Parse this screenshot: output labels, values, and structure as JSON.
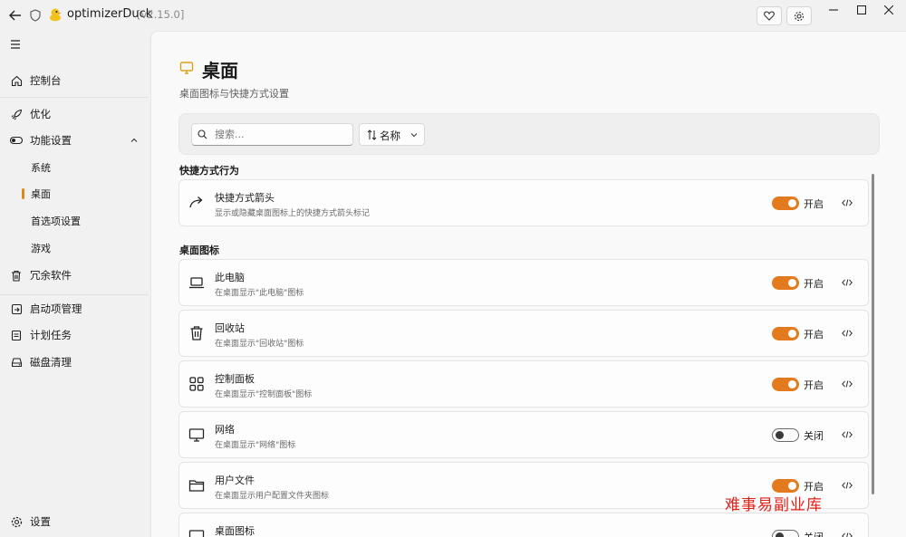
{
  "app": {
    "title": "optimizerDuck",
    "version": "[v2.15.0]"
  },
  "colors": {
    "accent": "#e47a1e",
    "active_indicator": "#d98b1c",
    "watermark": "#e0211a"
  },
  "sidebar": {
    "items": [
      {
        "label": "控制台",
        "icon": "home-icon"
      },
      {
        "label": "优化",
        "icon": "rocket-icon"
      },
      {
        "label": "功能设置",
        "icon": "toggle-icon",
        "expanded": true
      },
      {
        "label": "系统"
      },
      {
        "label": "桌面",
        "active": true
      },
      {
        "label": "首选项设置"
      },
      {
        "label": "游戏"
      },
      {
        "label": "冗余软件",
        "icon": "trash-icon"
      },
      {
        "label": "启动项管理",
        "icon": "startup-icon"
      },
      {
        "label": "计划任务",
        "icon": "task-icon"
      },
      {
        "label": "磁盘清理",
        "icon": "disk-icon"
      }
    ],
    "settings_label": "设置"
  },
  "page": {
    "title": "桌面",
    "subtitle": "桌面图标与快捷方式设置",
    "search_placeholder": "搜索...",
    "sort_label": "名称"
  },
  "sections": [
    {
      "heading": "快捷方式行为",
      "cards": [
        {
          "title": "快捷方式箭头",
          "desc": "显示或隐藏桌面图标上的快捷方式箭头标记",
          "state": "开启",
          "on": true,
          "icon": "arrow-icon"
        }
      ]
    },
    {
      "heading": "桌面图标",
      "cards": [
        {
          "title": "此电脑",
          "desc": "在桌面显示\"此电脑\"图标",
          "state": "开启",
          "on": true,
          "icon": "laptop-icon"
        },
        {
          "title": "回收站",
          "desc": "在桌面显示\"回收站\"图标",
          "state": "开启",
          "on": true,
          "icon": "recycle-bin-icon"
        },
        {
          "title": "控制面板",
          "desc": "在桌面显示\"控制面板\"图标",
          "state": "开启",
          "on": true,
          "icon": "grid-icon"
        },
        {
          "title": "网络",
          "desc": "在桌面显示\"网络\"图标",
          "state": "关闭",
          "on": false,
          "icon": "monitor-icon"
        },
        {
          "title": "用户文件",
          "desc": "在桌面显示用户配置文件夹图标",
          "state": "开启",
          "on": true,
          "icon": "folder-icon"
        },
        {
          "title": "桌面图标",
          "desc": "",
          "state": "关闭",
          "on": false,
          "icon": "desktop-icon"
        }
      ]
    }
  ],
  "watermark": "难事易副业库"
}
